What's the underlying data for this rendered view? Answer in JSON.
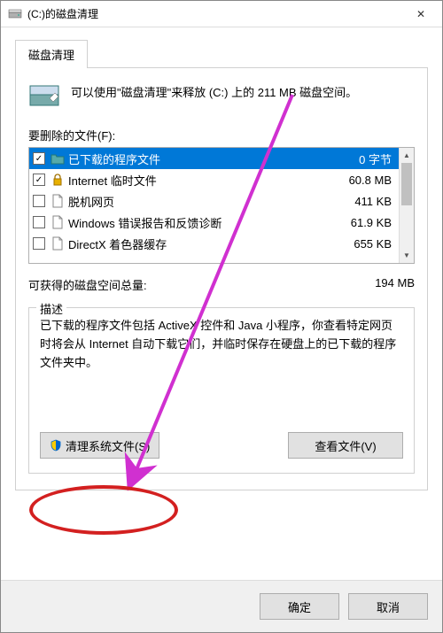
{
  "window": {
    "title": "(C:)的磁盘清理",
    "close_label": "✕"
  },
  "tab": {
    "label": "磁盘清理"
  },
  "intro": {
    "text": "可以使用\"磁盘清理\"来释放  (C:) 上的 211 MB 磁盘空间。"
  },
  "files_label": "要删除的文件(F):",
  "items": [
    {
      "checked": true,
      "name": "已下载的程序文件",
      "size": "0 字节",
      "selected": true,
      "icon": "folder"
    },
    {
      "checked": true,
      "name": "Internet 临时文件",
      "size": "60.8 MB",
      "selected": false,
      "icon": "lock"
    },
    {
      "checked": false,
      "name": "脱机网页",
      "size": "411 KB",
      "selected": false,
      "icon": "page"
    },
    {
      "checked": false,
      "name": "Windows 错误报告和反馈诊断",
      "size": "61.9 KB",
      "selected": false,
      "icon": "page"
    },
    {
      "checked": false,
      "name": "DirectX 着色器缓存",
      "size": "655 KB",
      "selected": false,
      "icon": "page"
    }
  ],
  "total": {
    "label": "可获得的磁盘空间总量:",
    "value": "194 MB"
  },
  "desc": {
    "legend": "描述",
    "text": "已下载的程序文件包括 ActiveX 控件和 Java 小程序，你查看特定网页时将会从 Internet 自动下载它们，并临时保存在硬盘上的已下载的程序文件夹中。",
    "clean_system": "清理系统文件(S)",
    "view_files": "查看文件(V)"
  },
  "dialog": {
    "ok": "确定",
    "cancel": "取消"
  }
}
